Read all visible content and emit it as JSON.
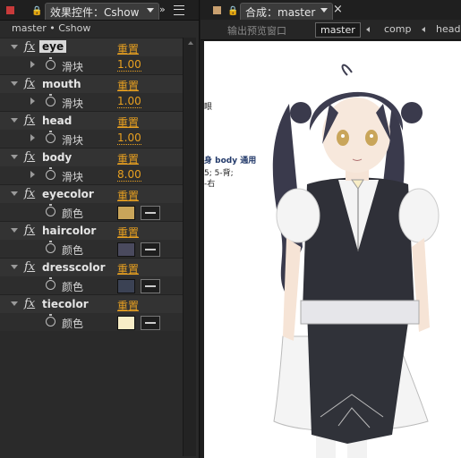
{
  "effect_panel": {
    "tab_title": "效果控件：Cshow",
    "subtitle": "master • Cshow",
    "effects": [
      {
        "name": "eye",
        "reset": "重置",
        "param_label": "滑块",
        "param_value": "1.00",
        "selected": true
      },
      {
        "name": "mouth",
        "reset": "重置",
        "param_label": "滑块",
        "param_value": "1.00"
      },
      {
        "name": "head",
        "reset": "重置",
        "param_label": "滑块",
        "param_value": "1.00"
      },
      {
        "name": "body",
        "reset": "重置",
        "param_label": "滑块",
        "param_value": "8.00"
      },
      {
        "name": "eyecolor",
        "reset": "重置",
        "param_label": "颜色",
        "color": "#c9a55a"
      },
      {
        "name": "haircolor",
        "reset": "重置",
        "param_label": "颜色",
        "color": "#4a4a5e"
      },
      {
        "name": "dresscolor",
        "reset": "重置",
        "param_label": "颜色",
        "color": "#3b4254"
      },
      {
        "name": "tiecolor",
        "reset": "重置",
        "param_label": "颜色",
        "color": "#f8edc6"
      }
    ],
    "fx_label": "fx"
  },
  "comp_panel": {
    "tab_title": "合成：master",
    "close_label": "×",
    "toolbar_hint": "输出预览窗口",
    "breadcrumbs": [
      "master",
      "comp",
      "head"
    ],
    "behind_text": {
      "line1": "眼",
      "line2": "身 body 通用",
      "line3": "5; 5-背;",
      "line4": "-右"
    }
  },
  "colors": {
    "accent": "#e8a020",
    "tab_red": "#c83a3a",
    "tab_tan": "#c9a070"
  }
}
